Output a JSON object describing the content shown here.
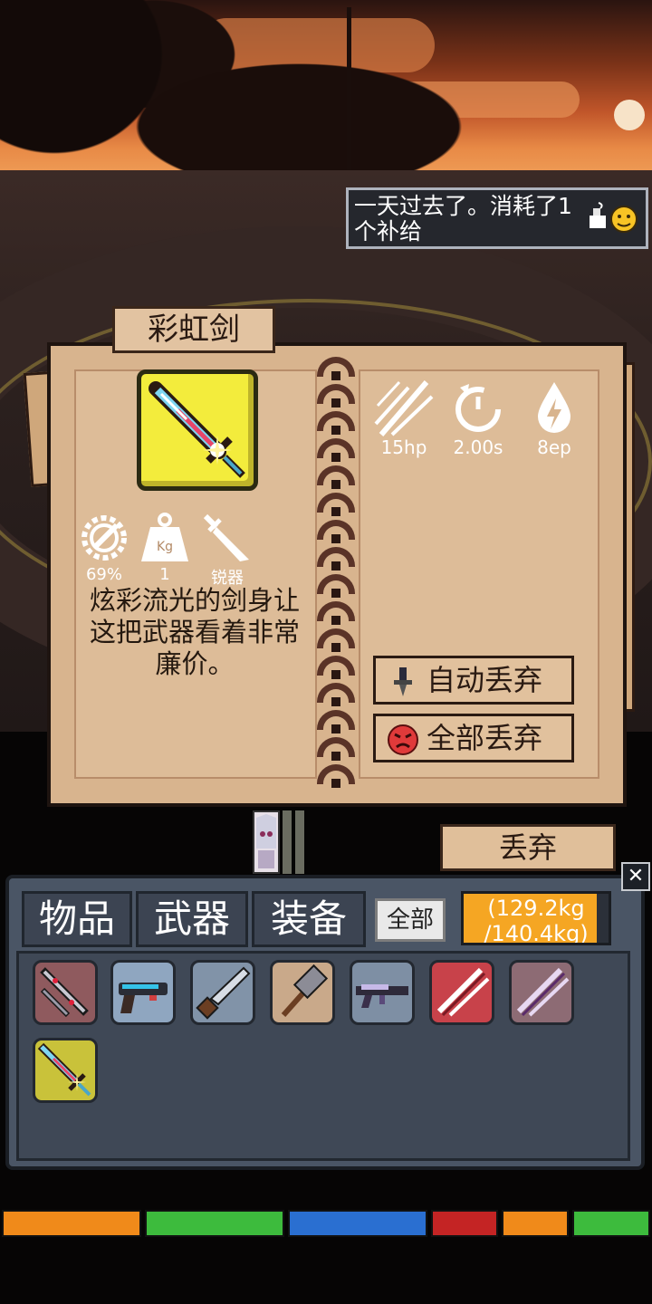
{
  "notification": {
    "text": "一天过去了。消耗了1个补给",
    "icon": "supply-pot-icon"
  },
  "item": {
    "name": "彩虹剑",
    "durability": "69%",
    "weight": "1",
    "weight_unit": "Kg",
    "type": "锐器",
    "description": "炫彩流光的剑身让这把武器看着非常廉价。",
    "stats": {
      "damage": "15hp",
      "cooldown": "2.00s",
      "energy": "8ep"
    },
    "auto_discard_label": "自动丢弃",
    "discard_all_label": "全部丢弃",
    "discard_label": "丢弃"
  },
  "inventory": {
    "tabs": [
      "物品",
      "武器",
      "装备"
    ],
    "filter_label": "全部",
    "weight_text": "(129.2kg\n/140.4kg)",
    "weight_used": 129.2,
    "weight_max": 140.4,
    "close_label": "✕",
    "slots": [
      {
        "icon": "crimson-sword-icon",
        "color": "#8f5a5e"
      },
      {
        "icon": "blaster-gun-icon",
        "color": "#8fa6c0"
      },
      {
        "icon": "machete-icon",
        "color": "#8193a8"
      },
      {
        "icon": "hammer-icon",
        "color": "#c9a98a"
      },
      {
        "icon": "rifle-icon",
        "color": "#7e8fa4"
      },
      {
        "icon": "red-dual-blades-icon",
        "color": "#c8424a"
      },
      {
        "icon": "purple-dual-blades-icon",
        "color": "#8d6b74"
      },
      {
        "icon": "rainbow-sword-icon",
        "color": "#c9c23a",
        "selected": true
      }
    ]
  },
  "colors": {
    "accent": "#f5a623",
    "paper": "#d8b48e",
    "panel": "#4a5565"
  }
}
